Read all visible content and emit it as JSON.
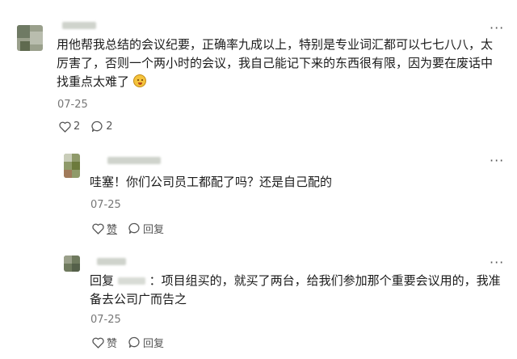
{
  "comments": [
    {
      "text": "用他帮我总结的会议纪要，正确率九成以上，特别是专业词汇都可以七七八八，太厉害了，否则一个两小时的会议，我自己能记下来的东西很有限，因为要在废话中找重点太难了",
      "date": "07-25",
      "like_count": "2",
      "reply_count": "2"
    },
    {
      "text": "哇塞！你们公司员工都配了吗？还是自己配的",
      "date": "07-25",
      "like_label": "赞",
      "reply_label": "回复"
    },
    {
      "reply_prefix": "回复",
      "text": "：项目组买的，就买了两台，给我们参加那个重要会议用的，我准备去公司广而告之",
      "date": "07-25",
      "like_label": "赞",
      "reply_label": "回复"
    }
  ],
  "icons": {
    "more": "more-icon",
    "like": "heart-icon",
    "reply": "comment-bubble-icon",
    "emoji": "grinning-face-emoji"
  }
}
